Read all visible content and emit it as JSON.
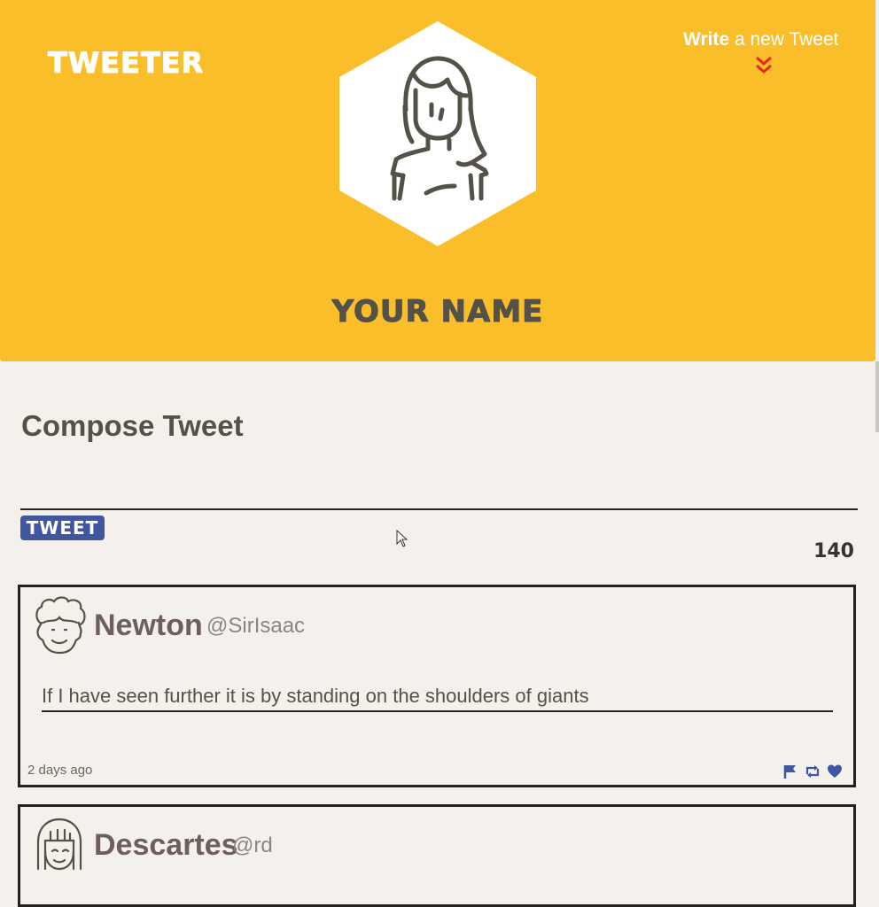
{
  "header": {
    "brand": "Tweeter",
    "write_bold": "Write",
    "write_rest": " a new Tweet",
    "profile_name": "Your Name"
  },
  "compose": {
    "title": "Compose Tweet",
    "input_value": "",
    "button_label": "Tweet",
    "counter": "140"
  },
  "tweets": [
    {
      "name": "Newton",
      "handle": "@SirIsaac",
      "content": "If I have seen further it is by standing on the shoulders of giants",
      "time": "2 days ago",
      "actions": [
        "flag-icon",
        "retweet-icon",
        "heart-icon"
      ]
    },
    {
      "name": "Descartes",
      "handle": "@rd"
    }
  ],
  "colors": {
    "header_bg": "#fbbe2b",
    "page_bg": "#f4f1ec",
    "accent": "#4056a1",
    "chevron": "#e8281c",
    "text": "#545149"
  }
}
